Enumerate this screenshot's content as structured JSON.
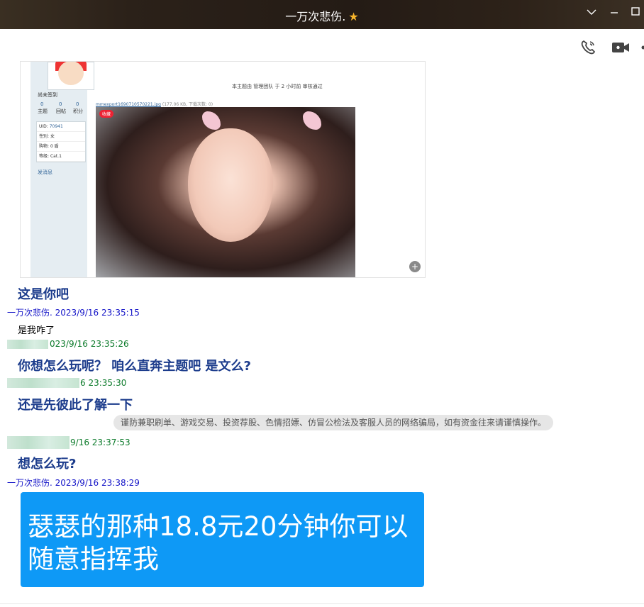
{
  "window": {
    "title": "一万次悲伤.",
    "title_icon": "star-icon",
    "controls": [
      "chevron-down-icon",
      "minimize-icon",
      "maximize-icon"
    ]
  },
  "toolbar": {
    "icons": [
      "voice-call-icon",
      "video-call-icon",
      "more-icon"
    ]
  },
  "forum_screenshot": {
    "side_status": "尚未签到",
    "stats": [
      {
        "value": "0",
        "label": "主题"
      },
      {
        "value": "0",
        "label": "回帖"
      },
      {
        "value": "0",
        "label": "积分"
      }
    ],
    "info": [
      {
        "label": "UID:",
        "value": "70941"
      },
      {
        "label": "性别:",
        "value": "女"
      },
      {
        "label": "购物:",
        "value": "0 盾"
      },
      {
        "label": "等级:",
        "value": "Cat.1"
      }
    ],
    "send_msg": "发消息",
    "note": "本主题由 管理团队 于 2 小时前 审核通过",
    "file_link": "mmexport1690710570221.jpg",
    "file_meta": "(177.06 KB, 下载次数: 0)",
    "photo_badge": "收藏"
  },
  "messages": [
    {
      "text": "这是你吧",
      "style": "bold"
    },
    {
      "sender": "一万次悲伤.",
      "time": "2023/9/16 23:35:15",
      "style": "blue"
    },
    {
      "text": "是我咋了",
      "style": "normal"
    },
    {
      "time": "023/9/16 23:35:26",
      "style": "green"
    },
    {
      "text": "你想怎么玩呢？ 咱么直奔主题吧 是文么?",
      "style": "bold"
    },
    {
      "time": "6 23:35:30",
      "style": "green"
    },
    {
      "text": "还是先彼此了解一下",
      "style": "bold"
    },
    {
      "time": "9/16 23:37:53",
      "style": "green"
    },
    {
      "text": "想怎么玩?",
      "style": "bold"
    },
    {
      "sender": "一万次悲伤.",
      "time": "2023/9/16 23:38:29",
      "style": "blue"
    }
  ],
  "notice": "谨防兼职刷单、游戏交易、投资荐股、色情招嫖、仿冒公检法及客服人员的网络骗局，如有资金往来请谨慎操作。",
  "image_message": {
    "line1": "瑟瑟的那种18.8元20分钟你可以",
    "line2": "随意指挥我",
    "bg_color": "#0e99f6"
  }
}
